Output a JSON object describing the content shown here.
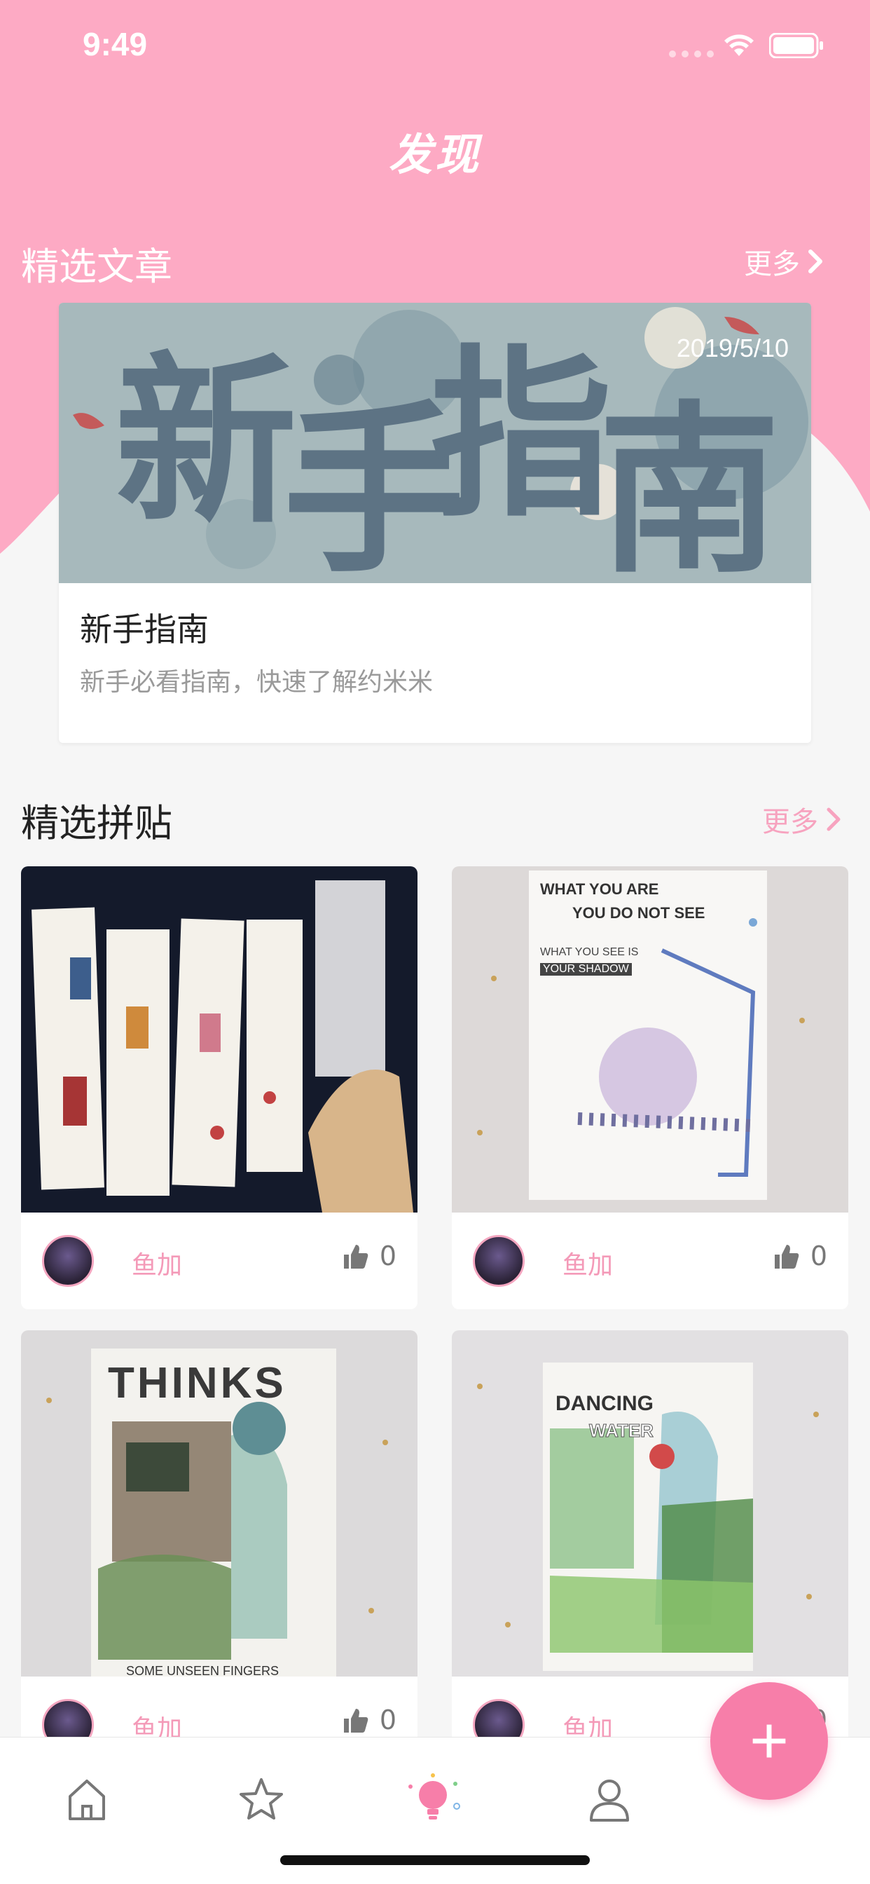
{
  "status_bar": {
    "time": "9:49"
  },
  "header": {
    "title": "发现"
  },
  "featured_articles": {
    "section_title": "精选文章",
    "more_label": "更多",
    "card": {
      "banner_text": [
        "新",
        "手",
        "指",
        "南"
      ],
      "date": "2019/5/10",
      "title": "新手指南",
      "description": "新手必看指南，快速了解约米米"
    }
  },
  "featured_collages": {
    "section_title": "精选拼贴",
    "more_label": "更多",
    "items": [
      {
        "author": "鱼加",
        "likes": "0",
        "photo_text": []
      },
      {
        "author": "鱼加",
        "likes": "0",
        "photo_text": [
          "WHAT YOU ARE",
          "YOU DO NOT SEE",
          "WHAT YOU SEE IS",
          "YOUR SHADOW"
        ]
      },
      {
        "author": "鱼加",
        "likes": "0",
        "photo_text": [
          "THINKS",
          "SOME UNSEEN FINGERS"
        ]
      },
      {
        "author": "鱼加",
        "likes": "0",
        "photo_text": [
          "DANCING",
          "WATER"
        ]
      }
    ]
  },
  "fab": {
    "label": "+"
  },
  "tab_bar": {
    "tabs": [
      {
        "icon": "home-icon"
      },
      {
        "icon": "star-icon"
      },
      {
        "icon": "lightbulb-icon",
        "active": true
      },
      {
        "icon": "profile-icon"
      }
    ]
  },
  "colors": {
    "brand_pink": "#fdaac4",
    "accent_pink": "#f77ea9",
    "author_pink": "#f49ab8"
  }
}
